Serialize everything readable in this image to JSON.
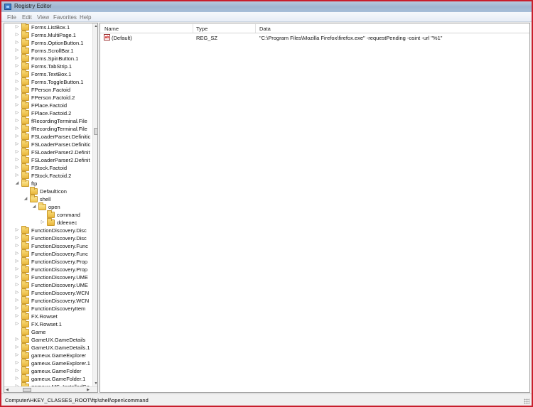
{
  "window": {
    "title": "Registry Editor"
  },
  "menu": [
    "File",
    "Edit",
    "View",
    "Favorites",
    "Help"
  ],
  "tree": {
    "items": [
      {
        "label": "Forms.ListBox.1",
        "level": 2,
        "expander": "closed"
      },
      {
        "label": "Forms.MultiPage.1",
        "level": 2,
        "expander": "closed"
      },
      {
        "label": "Forms.OptionButton.1",
        "level": 2,
        "expander": "closed"
      },
      {
        "label": "Forms.ScrollBar.1",
        "level": 2,
        "expander": "closed"
      },
      {
        "label": "Forms.SpinButton.1",
        "level": 2,
        "expander": "closed"
      },
      {
        "label": "Forms.TabStrip.1",
        "level": 2,
        "expander": "closed"
      },
      {
        "label": "Forms.TextBox.1",
        "level": 2,
        "expander": "closed"
      },
      {
        "label": "Forms.ToggleButton.1",
        "level": 2,
        "expander": "closed"
      },
      {
        "label": "FPerson.Factoid",
        "level": 2,
        "expander": "closed"
      },
      {
        "label": "FPerson.Factoid.2",
        "level": 2,
        "expander": "closed"
      },
      {
        "label": "FPlace.Factoid",
        "level": 2,
        "expander": "closed"
      },
      {
        "label": "FPlace.Factoid.2",
        "level": 2,
        "expander": "closed"
      },
      {
        "label": "fRecordingTerminal.File",
        "level": 2,
        "expander": "closed"
      },
      {
        "label": "fRecordingTerminal.File",
        "level": 2,
        "expander": "closed"
      },
      {
        "label": "FSLoaderParser.Definitic",
        "level": 2,
        "expander": "closed"
      },
      {
        "label": "FSLoaderParser.Definitic",
        "level": 2,
        "expander": "closed"
      },
      {
        "label": "FSLoaderParser2.Definit",
        "level": 2,
        "expander": "closed"
      },
      {
        "label": "FSLoaderParser2.Definit",
        "level": 2,
        "expander": "closed"
      },
      {
        "label": "FStock.Factoid",
        "level": 2,
        "expander": "closed"
      },
      {
        "label": "FStock.Factoid.2",
        "level": 2,
        "expander": "closed"
      },
      {
        "label": "ftp",
        "level": 2,
        "expander": "open"
      },
      {
        "label": "DefaultIcon",
        "level": 3,
        "expander": "none"
      },
      {
        "label": "shell",
        "level": 3,
        "expander": "open"
      },
      {
        "label": "open",
        "level": 4,
        "expander": "open"
      },
      {
        "label": "command",
        "level": 5,
        "expander": "none"
      },
      {
        "label": "ddeexec",
        "level": 5,
        "expander": "closed"
      },
      {
        "label": "FunctionDiscovery.Disc",
        "level": 2,
        "expander": "closed"
      },
      {
        "label": "FunctionDiscovery.Disc",
        "level": 2,
        "expander": "closed"
      },
      {
        "label": "FunctionDiscovery.Func",
        "level": 2,
        "expander": "closed"
      },
      {
        "label": "FunctionDiscovery.Func",
        "level": 2,
        "expander": "closed"
      },
      {
        "label": "FunctionDiscovery.Prop",
        "level": 2,
        "expander": "closed"
      },
      {
        "label": "FunctionDiscovery.Prop",
        "level": 2,
        "expander": "closed"
      },
      {
        "label": "FunctionDiscovery.UME",
        "level": 2,
        "expander": "closed"
      },
      {
        "label": "FunctionDiscovery.UME",
        "level": 2,
        "expander": "closed"
      },
      {
        "label": "FunctionDiscovery.WCN",
        "level": 2,
        "expander": "closed"
      },
      {
        "label": "FunctionDiscovery.WCN",
        "level": 2,
        "expander": "closed"
      },
      {
        "label": "FunctionDiscoveryItem",
        "level": 2,
        "expander": "closed"
      },
      {
        "label": "FX.Rowset",
        "level": 2,
        "expander": "closed"
      },
      {
        "label": "FX.Rowset.1",
        "level": 2,
        "expander": "closed"
      },
      {
        "label": "Game",
        "level": 2,
        "expander": "none"
      },
      {
        "label": "GameUX.GameDetails",
        "level": 2,
        "expander": "closed"
      },
      {
        "label": "GameUX.GameDetails.1",
        "level": 2,
        "expander": "closed"
      },
      {
        "label": "gameux.GameExplorer",
        "level": 2,
        "expander": "closed"
      },
      {
        "label": "gameux.GameExplorer.1",
        "level": 2,
        "expander": "closed"
      },
      {
        "label": "gameux.GameFolder",
        "level": 2,
        "expander": "closed"
      },
      {
        "label": "gameux.GameFolder.1",
        "level": 2,
        "expander": "closed"
      },
      {
        "label": "gameux.MS_InstalledGa",
        "level": 2,
        "expander": "closed"
      }
    ]
  },
  "list": {
    "columns": [
      "Name",
      "Type",
      "Data"
    ],
    "rows": [
      {
        "name": "(Default)",
        "type": "REG_SZ",
        "data": "\"C:\\Program Files\\Mozilla Firefox\\firefox.exe\" -requestPending -osint -url \"%1\"",
        "icon": "ab-string-icon"
      }
    ]
  },
  "status": {
    "path": "Computer\\HKEY_CLASSES_ROOT\\ftp\\shell\\open\\command"
  }
}
